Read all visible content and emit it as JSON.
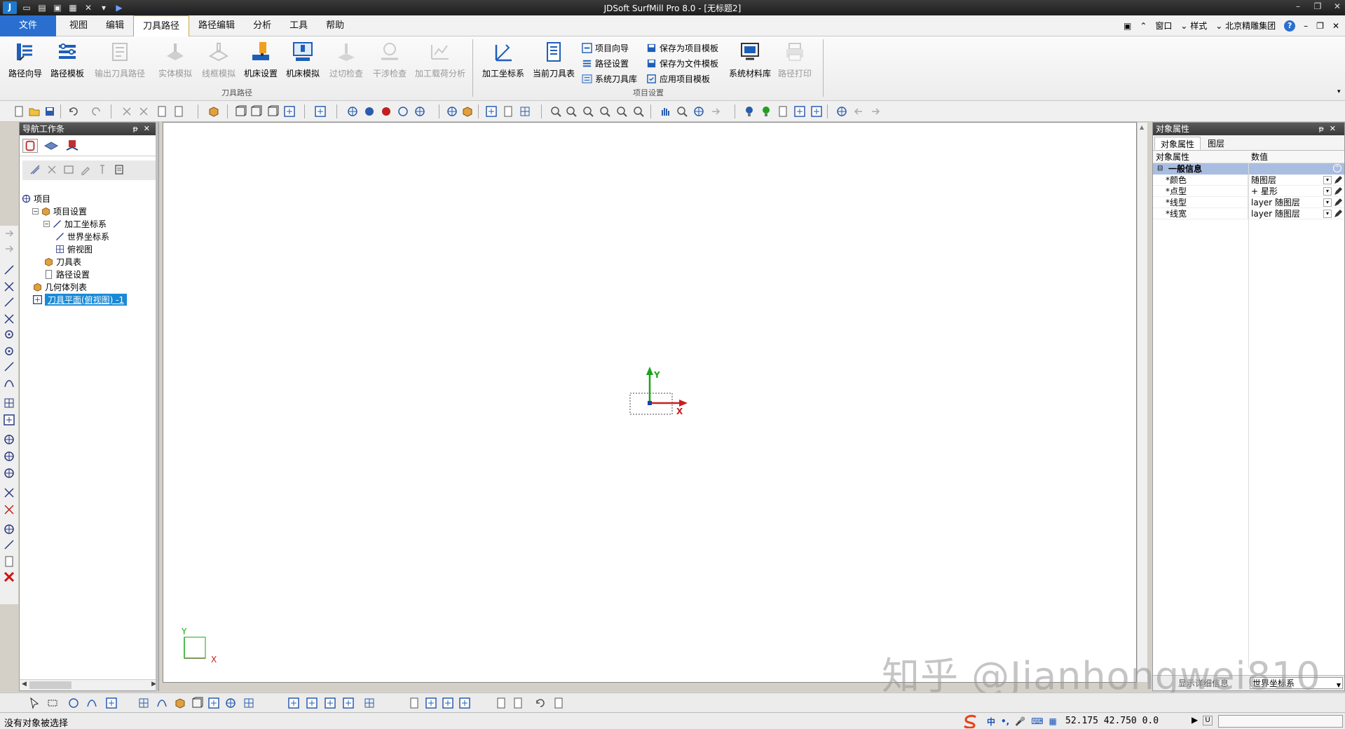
{
  "window": {
    "title": "JDSoft SurfMill Pro 8.0 - [无标题2]"
  },
  "menu": {
    "file": "文件",
    "tabs": [
      "视图",
      "编辑",
      "刀具路径",
      "路径编辑",
      "分析",
      "工具",
      "帮助"
    ],
    "active_tab": "刀具路径",
    "right": {
      "window": "窗口",
      "style": "样式",
      "company": "北京精雕集团",
      "help": "?"
    }
  },
  "ribbon": {
    "toolpath_group": {
      "label": "刀具路径",
      "buttons": [
        {
          "label": "路径向导",
          "enabled": true
        },
        {
          "label": "路径模板",
          "enabled": true
        },
        {
          "label": "输出刀具路径",
          "enabled": false
        },
        {
          "label": "实体模拟",
          "enabled": false
        },
        {
          "label": "线框模拟",
          "enabled": false
        },
        {
          "label": "机床设置",
          "enabled": true
        },
        {
          "label": "机床模拟",
          "enabled": true
        },
        {
          "label": "过切检查",
          "enabled": false
        },
        {
          "label": "干涉检查",
          "enabled": false
        },
        {
          "label": "加工载荷分析",
          "enabled": false
        }
      ]
    },
    "project_group": {
      "label": "项目设置",
      "large": [
        {
          "label": "加工坐标系"
        },
        {
          "label": "当前刀具表"
        }
      ],
      "small_col1": [
        "项目向导",
        "路径设置",
        "系统刀具库"
      ],
      "small_col2": [
        "保存为项目模板",
        "保存为文件模板",
        "应用项目模板"
      ],
      "large_right": [
        {
          "label": "系统材料库",
          "enabled": true
        },
        {
          "label": "路径打印",
          "enabled": false
        }
      ]
    }
  },
  "nav_panel": {
    "title": "导航工作条",
    "tree": [
      {
        "label": "项目",
        "level": 0
      },
      {
        "label": "项目设置",
        "level": 1
      },
      {
        "label": "加工坐标系",
        "level": 2
      },
      {
        "label": "世界坐标系",
        "level": 3
      },
      {
        "label": "俯视图",
        "level": 3
      },
      {
        "label": "刀具表",
        "level": 2
      },
      {
        "label": "路径设置",
        "level": 2
      },
      {
        "label": "几何体列表",
        "level": 1
      },
      {
        "label": "刀具平面(俯视图) -1",
        "level": 1,
        "selected": true
      }
    ]
  },
  "viewport": {
    "axis_x": "X",
    "axis_y": "Y",
    "corner_x": "X",
    "corner_y": "Y"
  },
  "prop_panel": {
    "title": "对象属性",
    "tabs": [
      "对象属性",
      "图层"
    ],
    "col_name": "对象属性",
    "col_value": "数值",
    "group": "一般信息",
    "rows": [
      {
        "key": "*颜色",
        "value": "随图层"
      },
      {
        "key": "*点型",
        "value": "+ 星形"
      },
      {
        "key": "*线型",
        "value": "layer 随图层"
      },
      {
        "key": "*线宽",
        "value": "layer 随图层"
      }
    ],
    "bottom_label": "显示详细信息",
    "bottom_value": "世界坐标系"
  },
  "status": {
    "message": "没有对象被选择",
    "coords": "52.175 42.750 0.0",
    "ime": "中"
  },
  "watermark": "知乎 @Jianhongwei810",
  "colors": {
    "accent": "#2a6fcf",
    "axis_x": "#c62020",
    "axis_y": "#1aa51a",
    "selection": "#1a8ad6"
  }
}
